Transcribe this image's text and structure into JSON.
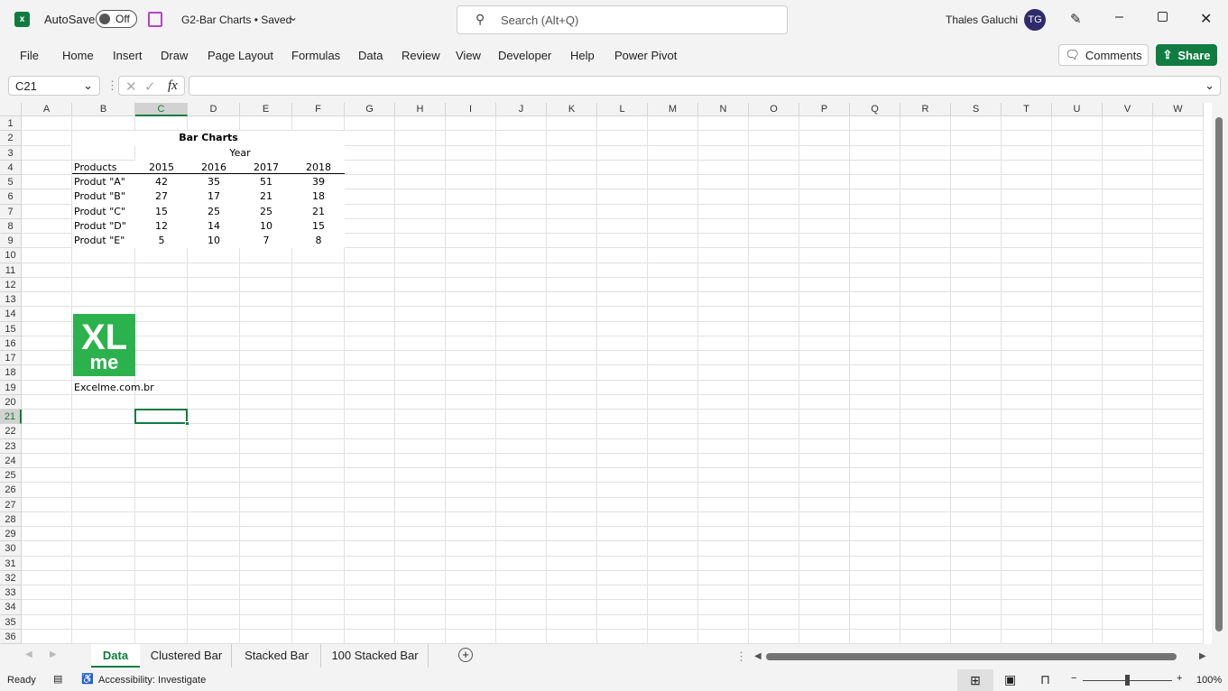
{
  "app": {
    "autosave_label": "AutoSave",
    "autosave_state": "Off",
    "doc_title": "G2-Bar Charts • Saved",
    "search_placeholder": "Search (Alt+Q)",
    "user_name": "Thales Galuchi",
    "user_initials": "TG",
    "accent": "#107c41"
  },
  "menu": [
    "File",
    "Home",
    "Insert",
    "Draw",
    "Page Layout",
    "Formulas",
    "Data",
    "Review",
    "View",
    "Developer",
    "Help",
    "Power Pivot"
  ],
  "ribbon": {
    "comments_label": "Comments",
    "share_label": "Share"
  },
  "formula_bar": {
    "name_box": "C21",
    "fx": "fx",
    "value": ""
  },
  "columns": [
    "A",
    "B",
    "C",
    "D",
    "E",
    "F",
    "G",
    "H",
    "I",
    "J",
    "K",
    "L",
    "M",
    "N",
    "O",
    "P",
    "Q",
    "R",
    "S",
    "T",
    "U",
    "V",
    "W"
  ],
  "rows": [
    "1",
    "2",
    "3",
    "4",
    "5",
    "6",
    "7",
    "8",
    "9",
    "10",
    "11",
    "12",
    "13",
    "14",
    "15",
    "16",
    "17",
    "18",
    "19",
    "20",
    "21",
    "22",
    "23",
    "24",
    "25",
    "26",
    "27",
    "28",
    "29",
    "30",
    "31",
    "32",
    "33",
    "34",
    "35",
    "36"
  ],
  "table": {
    "title": "Bar Charts",
    "group_header": "Year",
    "header": [
      "Products",
      "2015",
      "2016",
      "2017",
      "2018"
    ],
    "rows": [
      [
        "Produt \"A\"",
        "42",
        "35",
        "51",
        "39"
      ],
      [
        "Produt \"B\"",
        "27",
        "17",
        "21",
        "18"
      ],
      [
        "Produt \"C\"",
        "15",
        "25",
        "25",
        "21"
      ],
      [
        "Produt \"D\"",
        "12",
        "14",
        "10",
        "15"
      ],
      [
        "Produt \"E\"",
        "5",
        "10",
        "7",
        "8"
      ]
    ]
  },
  "logo": {
    "text_top": "XL",
    "text_bottom": "me",
    "watermark": "excelme.com.br",
    "color": "#2bb24c"
  },
  "site_link": "Excelme.com.br",
  "selected_cell": "C21",
  "sheets": [
    {
      "label": "Data",
      "active": true
    },
    {
      "label": "Clustered Bar"
    },
    {
      "label": "Stacked Bar"
    },
    {
      "label": "100 Stacked Bar"
    }
  ],
  "status": {
    "ready": "Ready",
    "accessibility": "Accessibility: Investigate",
    "zoom": "100%",
    "zoom_level_percent": 100
  }
}
